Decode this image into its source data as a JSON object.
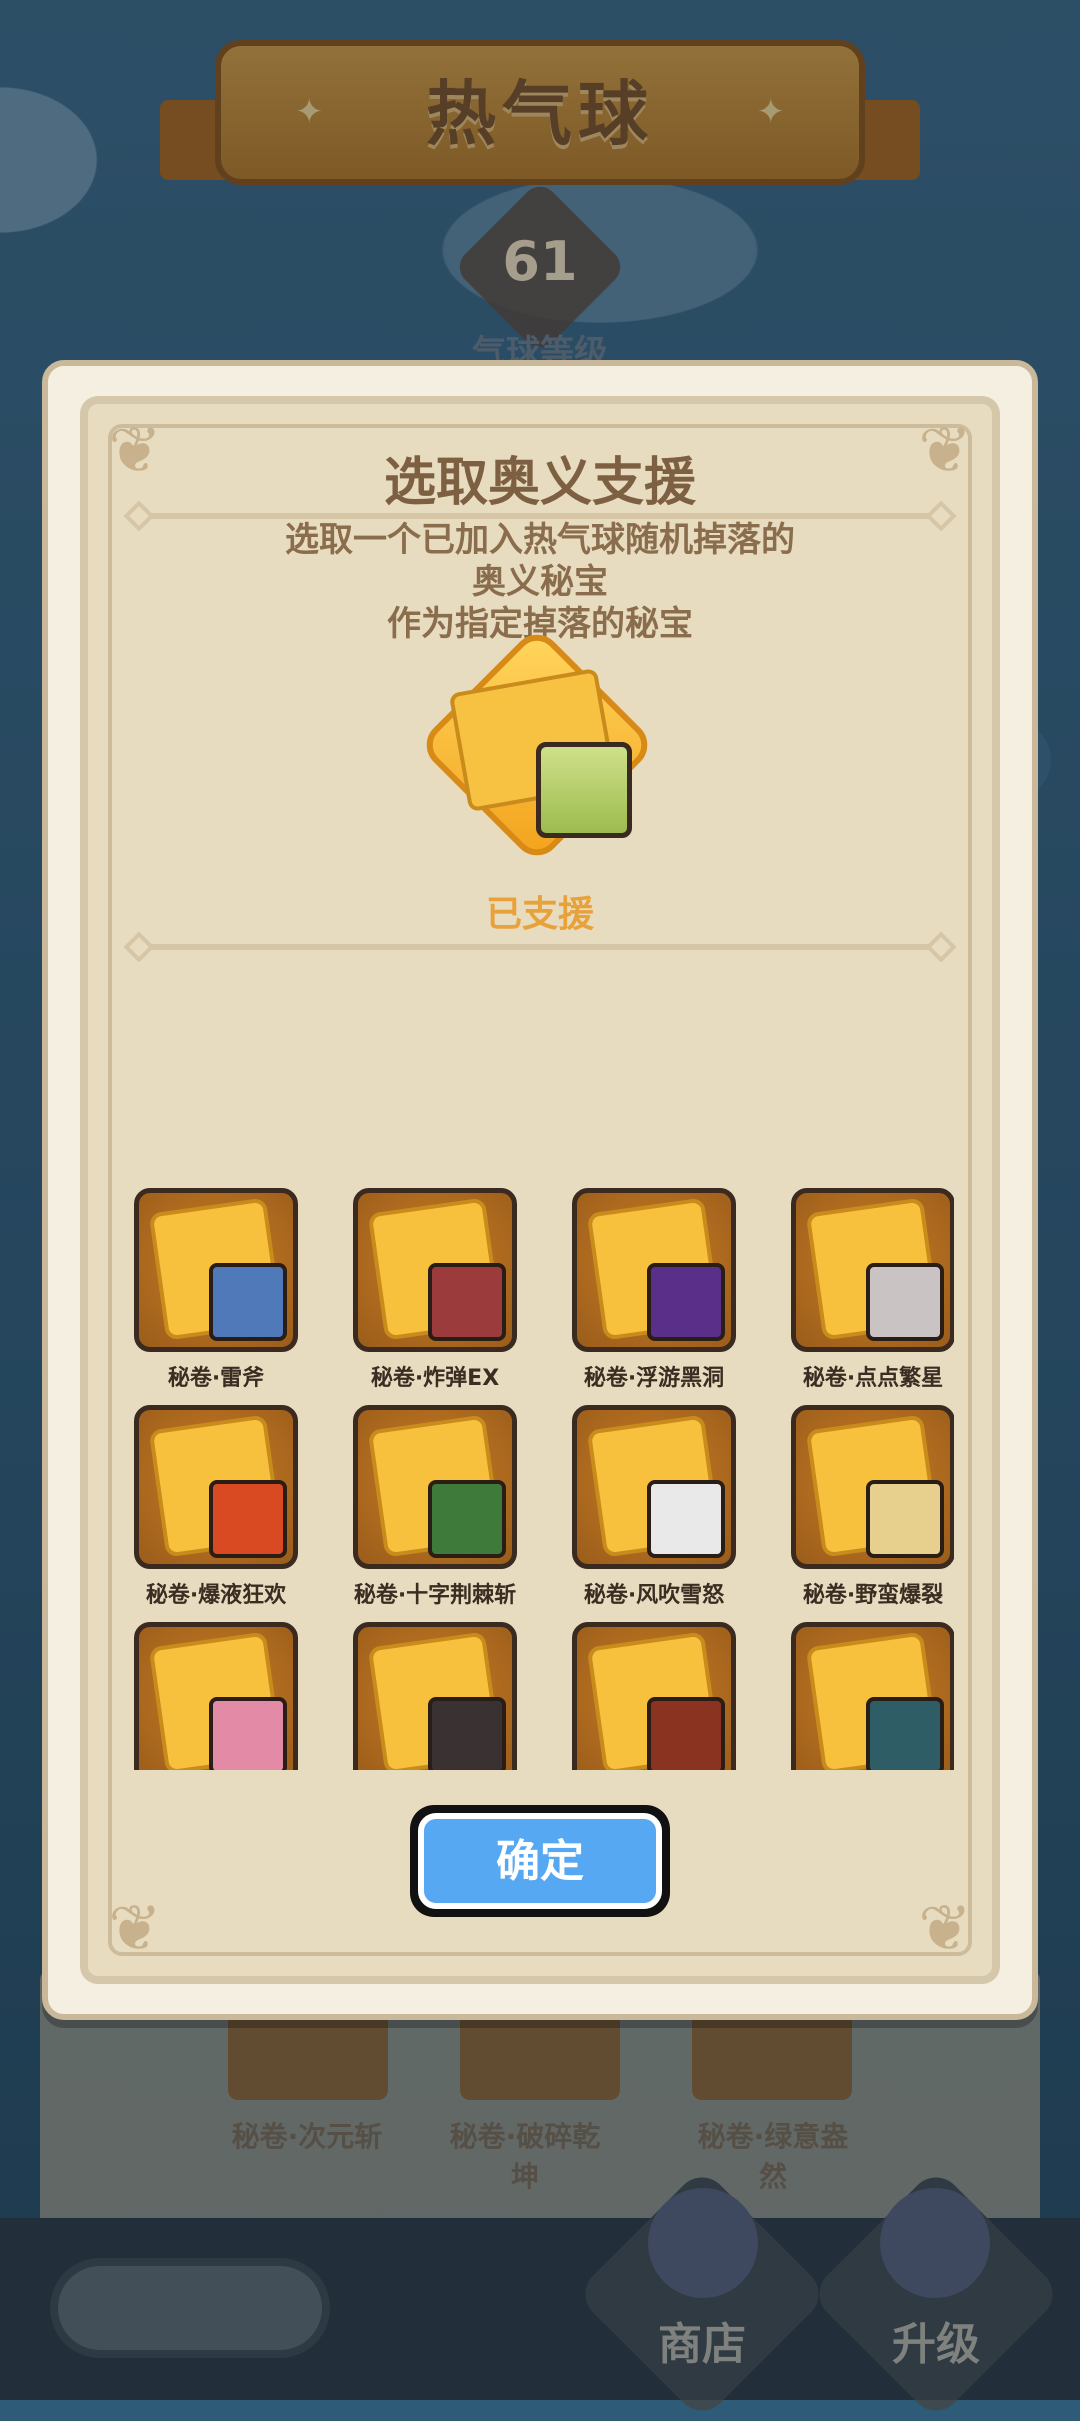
{
  "header": {
    "title": "热气球",
    "level_number": "61",
    "level_label": "气球等级"
  },
  "background_items": [
    {
      "name": "秘卷·次元斩"
    },
    {
      "name": "秘卷·破碎乾坤"
    },
    {
      "name": "秘卷·绿意盎然"
    }
  ],
  "bottom_nav": {
    "shop_label": "商店",
    "upgrade_label": "升级"
  },
  "modal": {
    "title": "选取奥义支援",
    "subtitle_line1": "选取一个已加入热气球随机掉落的",
    "subtitle_line2": "奥义秘宝",
    "subtitle_line3": "作为指定掉落的秘宝",
    "status": "已支援",
    "confirm_label": "确定",
    "items": [
      {
        "name": "秘卷·雷斧",
        "portrait_color": "#4f79b8"
      },
      {
        "name": "秘卷·炸弹EX",
        "portrait_color": "#9b3b3b"
      },
      {
        "name": "秘卷·浮游黑洞",
        "portrait_color": "#5a2f8a"
      },
      {
        "name": "秘卷·点点繁星",
        "portrait_color": "#c9c3c3"
      },
      {
        "name": "秘卷·爆液狂欢",
        "portrait_color": "#d94a22"
      },
      {
        "name": "秘卷·十字荆棘斩",
        "portrait_color": "#3e7b3a"
      },
      {
        "name": "秘卷·风吹雪怒",
        "portrait_color": "#e9e9e9"
      },
      {
        "name": "秘卷·野蛮爆裂",
        "portrait_color": "#e7cf8e"
      },
      {
        "name": "",
        "portrait_color": "#e38aa6"
      },
      {
        "name": "",
        "portrait_color": "#3a3232"
      },
      {
        "name": "",
        "portrait_color": "#8a3320"
      },
      {
        "name": "",
        "portrait_color": "#2f5d66"
      }
    ]
  },
  "colors": {
    "accent": "#56a8f2",
    "status": "#e8a23b",
    "title": "#7d6042"
  }
}
